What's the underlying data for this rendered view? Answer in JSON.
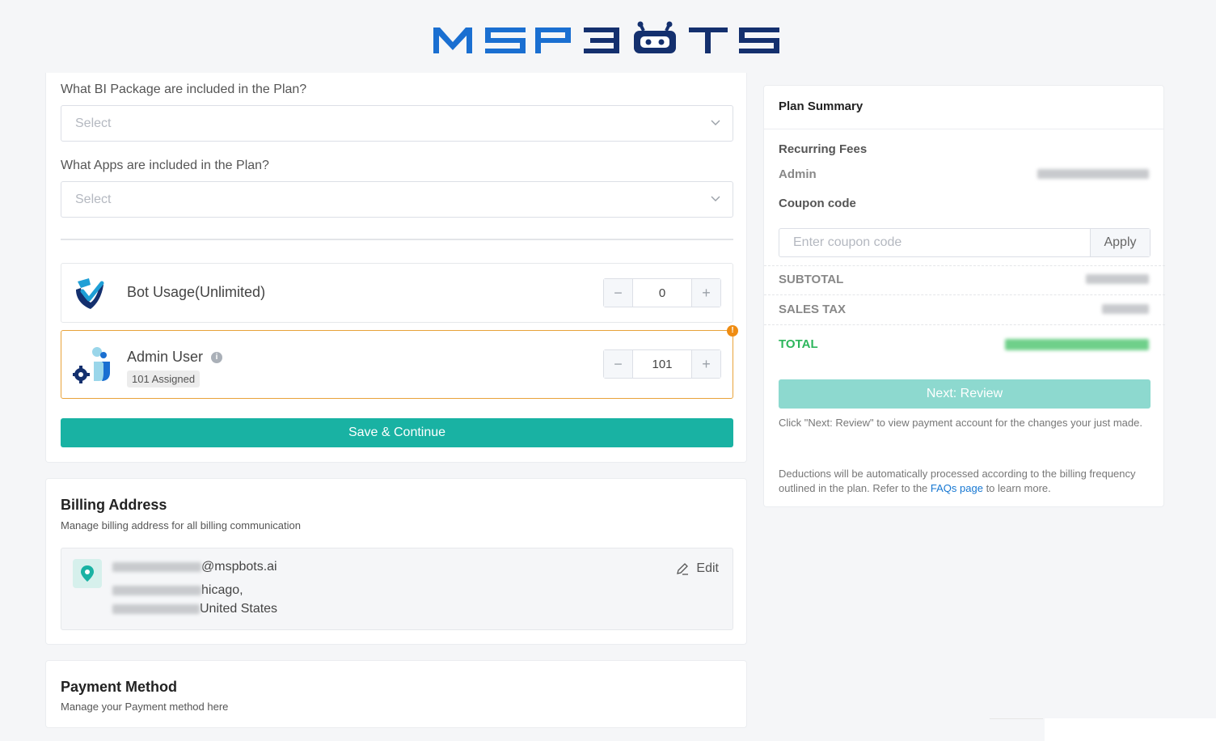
{
  "brand": {
    "logo_text": "MSPBOTS",
    "colors": {
      "blue": "#1a6fd1",
      "navy": "#14306e",
      "teal": "#19b2a3",
      "orange": "#ef8c12",
      "green": "#2db65c"
    }
  },
  "plan": {
    "bi_question": "What BI Package are included in the Plan?",
    "bi_placeholder": "Select",
    "apps_question": "What Apps are included in the Plan?",
    "apps_placeholder": "Select",
    "items": [
      {
        "name": "Bot Usage(Unlimited)",
        "value": "0",
        "icon": "checkmark-shield-icon"
      },
      {
        "name": "Admin User",
        "value": "101",
        "assigned": "101 Assigned",
        "icon": "admin-user-gear-icon"
      }
    ],
    "warning_mark": "!",
    "info_mark": "i",
    "save_label": "Save & Continue"
  },
  "billing": {
    "title": "Billing Address",
    "subtitle": "Manage billing address for all billing communication",
    "email_suffix": "@mspbots.ai",
    "city_suffix": "hicago,",
    "country": "United States",
    "edit_label": "Edit"
  },
  "payment": {
    "title": "Payment Method",
    "subtitle": "Manage your Payment method here"
  },
  "summary": {
    "title": "Plan Summary",
    "recurring_label": "Recurring Fees",
    "admin_label": "Admin",
    "coupon_label": "Coupon code",
    "coupon_placeholder": "Enter coupon code",
    "apply_label": "Apply",
    "subtotal_label": "SUBTOTAL",
    "tax_label": "SALES TAX",
    "total_label": "TOTAL",
    "next_label": "Next: Review",
    "note1": "Click \"Next: Review\" to view payment account for the changes your just made.",
    "note2_pre": "Deductions will be automatically processed according to the billing frequency outlined in the plan. Refer to the ",
    "faq_link": "FAQs page",
    "note2_post": " to learn more."
  }
}
